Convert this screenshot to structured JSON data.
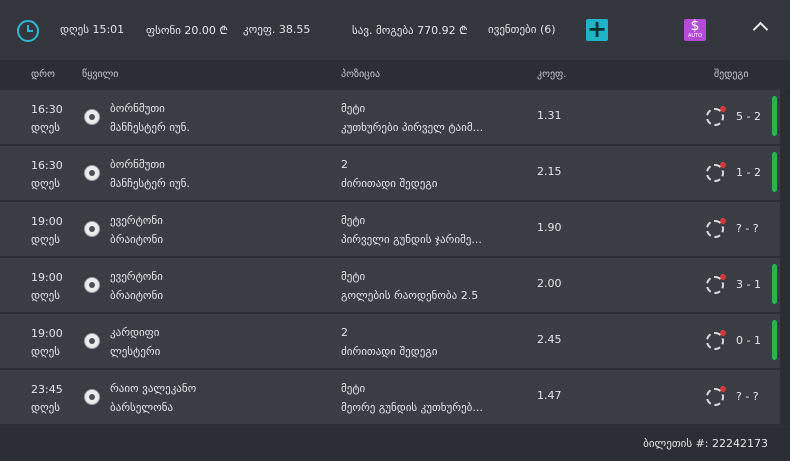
{
  "topbar": {
    "time": "დღეს 15:01",
    "stake": "ფსონი  20.00 ₾",
    "coef": "კოეფ.   38.55",
    "win": "სავ. მოგება   770.92 ₾",
    "events": "ივენთები (6)",
    "add_label": "+",
    "auto_symbol": "$",
    "auto_label": "AUTO"
  },
  "header": {
    "time": "დრო",
    "match": "წყვილი",
    "position": "პოზიცია",
    "coef": "კოეფ.",
    "status": "შედეგი"
  },
  "rows": [
    {
      "time": "16:30",
      "day": "დღეს",
      "team1": "ბორნმუთი",
      "team2": "მანჩესტერ იუნ.",
      "pick": "მეტი",
      "market": "კუთხურები პირველ ტაიმ...",
      "odds": "1.31",
      "score": "5 - 2",
      "bar": true
    },
    {
      "time": "16:30",
      "day": "დღეს",
      "team1": "ბორნმუთი",
      "team2": "მანჩესტერ იუნ.",
      "pick": "2",
      "market": "ძირითადი შედეგი",
      "odds": "2.15",
      "score": "1 - 2",
      "bar": true
    },
    {
      "time": "19:00",
      "day": "დღეს",
      "team1": "ევერტონი",
      "team2": "ბრაიტონი",
      "pick": "მეტი",
      "market": "პირველი გუნდის ჯარიმე...",
      "odds": "1.90",
      "score": "? - ?",
      "bar": false
    },
    {
      "time": "19:00",
      "day": "დღეს",
      "team1": "ევერტონი",
      "team2": "ბრაიტონი",
      "pick": "მეტი",
      "market": "გოლების რაოდენობა 2.5",
      "odds": "2.00",
      "score": "3 - 1",
      "bar": true
    },
    {
      "time": "19:00",
      "day": "დღეს",
      "team1": "კარდიფი",
      "team2": "ლესტერი",
      "pick": "2",
      "market": "ძირითადი შედეგი",
      "odds": "2.45",
      "score": "0 - 1",
      "bar": true
    },
    {
      "time": "23:45",
      "day": "დღეს",
      "team1": "რაიო ვალეკანო",
      "team2": "ბარსელონა",
      "pick": "მეტი",
      "market": "მეორე გუნდის კუთხურებ...",
      "odds": "1.47",
      "score": "? - ?",
      "bar": false
    }
  ],
  "footer": {
    "ticket": "ბილეთის #: 22242173"
  },
  "colors": {
    "accent": "#2fb6d3",
    "add": "#1fb3c7",
    "auto": "#b24bd6",
    "win_bar": "#2db34a",
    "live_dot": "#d23b3b"
  }
}
